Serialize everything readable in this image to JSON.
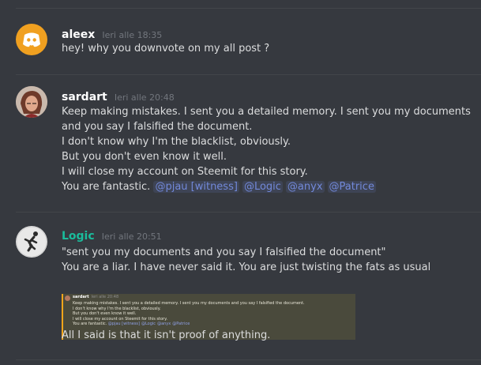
{
  "messages": [
    {
      "username": "aleex",
      "username_color": "#ffffff",
      "timestamp": "Ieri alle 18:35",
      "lines": [
        "hey! why you downvote on my all post ?"
      ]
    },
    {
      "username": "sardart",
      "username_color": "#ffffff",
      "timestamp": "Ieri alle 20:48",
      "lines": [
        "Keep making mistakes. I sent you a detailed memory. I sent you my documents",
        "and you say I falsified the document.",
        "I don't know why I'm the blacklist, obviously.",
        "But you don't even know it well.",
        "I will close my account on Steemit for this story."
      ],
      "last_line_text": "You are fantastic.",
      "mentions": [
        "@pjau [witness]",
        "@Logic",
        "@anyx",
        "@Patrice"
      ]
    },
    {
      "username": "Logic",
      "username_color": "#1abc9c",
      "timestamp": "Ieri alle 20:51",
      "lines": [
        "\"sent you my documents and you say I falsified the document\"",
        "You are a liar. I have never said it. You are just twisting the fats as usual"
      ],
      "after_embed": "All I said is that it isn't proof of anything."
    }
  ],
  "embed_screenshot": {
    "username": "sardart",
    "timestamp": "Ieri alle 20:48",
    "lines": [
      "Keep making mistakes. I sent you a detailed memory. I sent you my documents and you say I falsified the document.",
      "I don't know why I'm the blacklist, obviously.",
      "But you don't even know it well.",
      "I will close my account on Steemit for this story."
    ],
    "last_line_text": "You are fantastic.",
    "mentions": [
      "@pjau [witness]",
      "@Logic",
      "@anyx",
      "@Patrice"
    ]
  },
  "colors": {
    "background": "#36393f",
    "discord_blurple": "#f0a020",
    "mention": "#7289da",
    "logic_name": "#1abc9c",
    "embed_bar": "#faa61a"
  },
  "icons": {
    "aleex_avatar": "discord-logo-icon",
    "sardart_avatar": "user-photo",
    "logic_avatar": "running-figure-icon"
  }
}
